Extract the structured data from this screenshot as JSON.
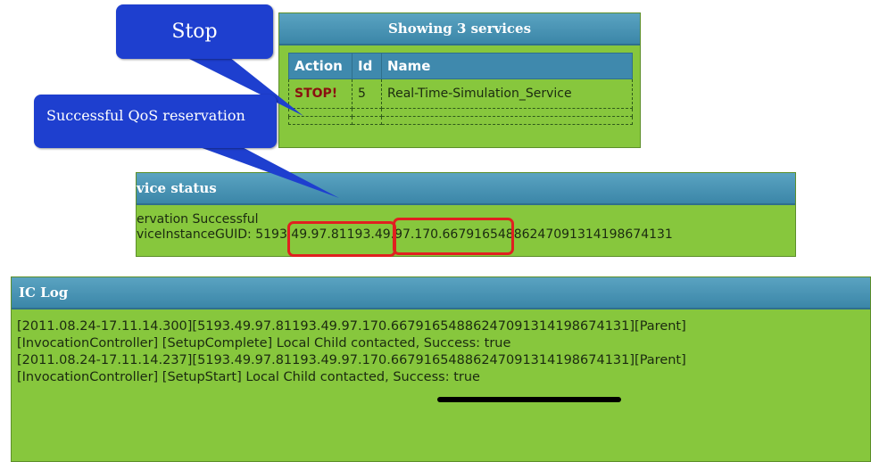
{
  "callouts": {
    "stop": "Stop",
    "qos": "Successful QoS reservation"
  },
  "services": {
    "header": "Showing 3 services",
    "columns": [
      "Action",
      "Id",
      "Name"
    ],
    "rows": [
      {
        "action": "STOP!",
        "id": "5",
        "name": "Real-Time-Simulation_Service"
      }
    ]
  },
  "status": {
    "header": "vice status",
    "line1": "ervation Successful",
    "line2_prefix": "viceInstanceGUID: 5",
    "ip1": "193.49.97.81",
    "ip2": "193.49.97.170",
    "line2_suffix": ".66791654886247091314198674131"
  },
  "log": {
    "header": "IC Log",
    "lines": [
      "[2011.08.24-17.11.14.300][5193.49.97.81193.49.97.170.66791654886247091314198674131][Parent]",
      "[InvocationController] [SetupComplete] Local Child contacted, Success: true",
      "[2011.08.24-17.11.14.237][5193.49.97.81193.49.97.170.66791654886247091314198674131][Parent]",
      "[InvocationController] [SetupStart] Local Child contacted, Success: true"
    ]
  },
  "colors": {
    "panel_bg": "#87c73d",
    "header_bg": "#3b86a8",
    "callout_bg": "#1e3fcf",
    "highlight": "#e02020"
  }
}
